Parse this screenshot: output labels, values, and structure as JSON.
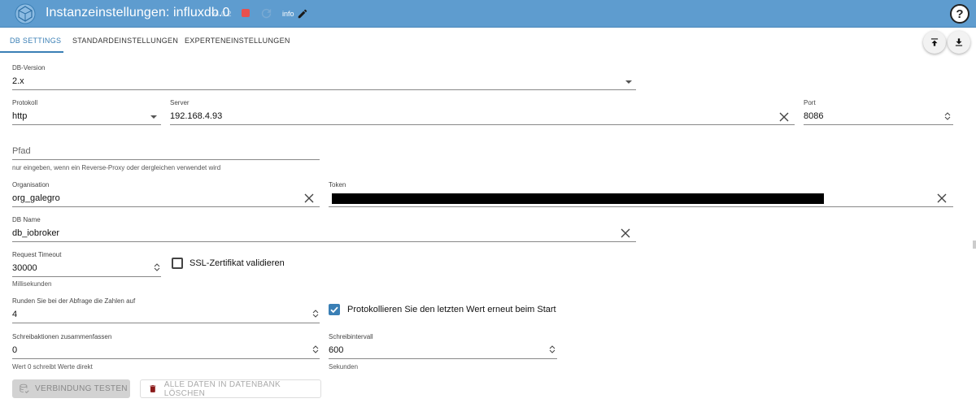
{
  "header": {
    "title": "Instanzeinstellungen: influxdb.0",
    "version": "v4.0.2",
    "info_label": "info",
    "help_symbol": "?",
    "bg_color": "#5e9ccf",
    "stop_color": "#e9504e"
  },
  "tabs": [
    {
      "label": "DB SETTINGS",
      "active": true
    },
    {
      "label": "STANDARDEINSTELLUNGEN",
      "active": false
    },
    {
      "label": "EXPERTENEINSTELLUNGEN",
      "active": false
    }
  ],
  "fields": {
    "db_version": {
      "label": "DB-Version",
      "value": "2.x"
    },
    "protocol": {
      "label": "Protokoll",
      "value": "http"
    },
    "server": {
      "label": "Server",
      "value": "192.168.4.93"
    },
    "port": {
      "label": "Port",
      "value": "8086"
    },
    "path": {
      "placeholder": "Pfad",
      "helper": "nur eingeben, wenn ein Reverse-Proxy oder dergleichen verwendet wird"
    },
    "organisation": {
      "label": "Organisation",
      "value": "org_galegro"
    },
    "token": {
      "label": "Token"
    },
    "db_name": {
      "label": "DB Name",
      "value": "db_iobroker"
    },
    "request_timeout": {
      "label": "Request Timeout",
      "value": "30000",
      "helper": "Millisekunden"
    },
    "ssl": {
      "label": "SSL-Zertifikat validieren",
      "checked": false
    },
    "round": {
      "label": "Runden Sie bei der Abfrage die Zahlen auf",
      "value": "4"
    },
    "log_last": {
      "label": "Protokollieren Sie den letzten Wert erneut beim Start",
      "checked": true
    },
    "batch": {
      "label": "Schreibaktionen zusammenfassen",
      "value": "0",
      "helper": "Wert 0 schreibt Werte direkt"
    },
    "write_interval": {
      "label": "Schreibintervall",
      "value": "600",
      "helper": "Sekunden"
    }
  },
  "buttons": {
    "test": "VERBINDUNG TESTEN",
    "delete": "ALLE DATEN IN DATENBANK LÖSCHEN"
  },
  "accent_color": "#3a7fb5"
}
